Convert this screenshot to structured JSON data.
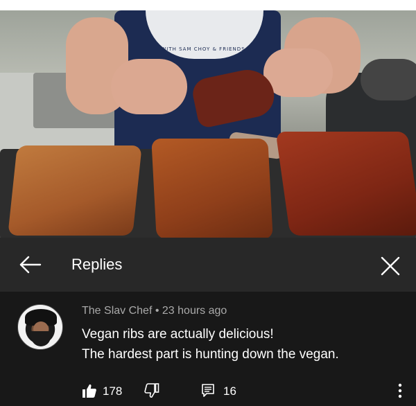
{
  "video": {
    "shirt_logo_text": "WITH SAM CHOY & FRIENDS"
  },
  "header": {
    "title": "Replies",
    "back_icon": "arrow-left-icon",
    "close_icon": "close-icon"
  },
  "comment": {
    "author": "The Slav Chef",
    "separator": "•",
    "timestamp": "23 hours ago",
    "text_line1": "Vegan ribs are actually delicious!",
    "text_line2": "The hardest part is hunting down the vegan.",
    "like_count": "178",
    "reply_count": "16",
    "like_icon": "thumbs-up-icon",
    "dislike_icon": "thumbs-down-icon",
    "reply_icon": "reply-comment-icon",
    "more_icon": "more-vertical-icon"
  },
  "colors": {
    "panel_bg": "#212121",
    "header_bg": "#282828",
    "comment_bg": "#181818",
    "meta_text": "#aaaaaa",
    "primary_text": "#ffffff"
  }
}
